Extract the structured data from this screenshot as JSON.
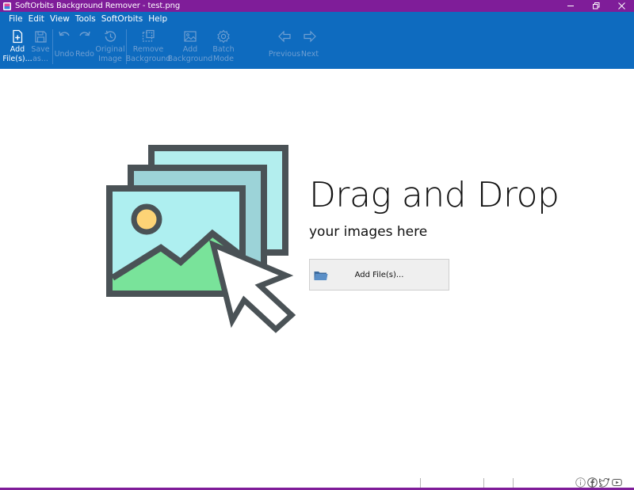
{
  "window": {
    "title": "SoftOrbits Background Remover - test.png",
    "accent_color": "#7f1d99",
    "ribbon_color": "#0e6bbf"
  },
  "menu": [
    "File",
    "Edit",
    "View",
    "Tools",
    "SoftOrbits",
    "Help"
  ],
  "toolbar": {
    "add_files": [
      "Add",
      "File(s)..."
    ],
    "save_as": [
      "Save",
      "as..."
    ],
    "undo": "Undo",
    "redo": "Redo",
    "original_image": [
      "Original",
      "Image"
    ],
    "remove_background": [
      "Remove",
      "Background"
    ],
    "add_background": [
      "Add",
      "Background"
    ],
    "batch_mode": [
      "Batch",
      "Mode"
    ],
    "previous": "Previous",
    "next": "Next"
  },
  "content": {
    "headline": "Drag and Drop",
    "subline": "your images here",
    "add_button_label": "Add File(s)..."
  },
  "icons": {
    "add_files": "add-file-icon",
    "save_as": "save-icon",
    "undo": "undo-icon",
    "redo": "redo-icon",
    "original_image": "history-icon",
    "remove_background": "remove-background-icon",
    "add_background": "image-icon",
    "batch_mode": "gear-icon",
    "previous": "arrow-left-icon",
    "next": "arrow-right-icon",
    "status": [
      "info-icon",
      "facebook-icon",
      "twitter-icon",
      "youtube-icon"
    ]
  }
}
